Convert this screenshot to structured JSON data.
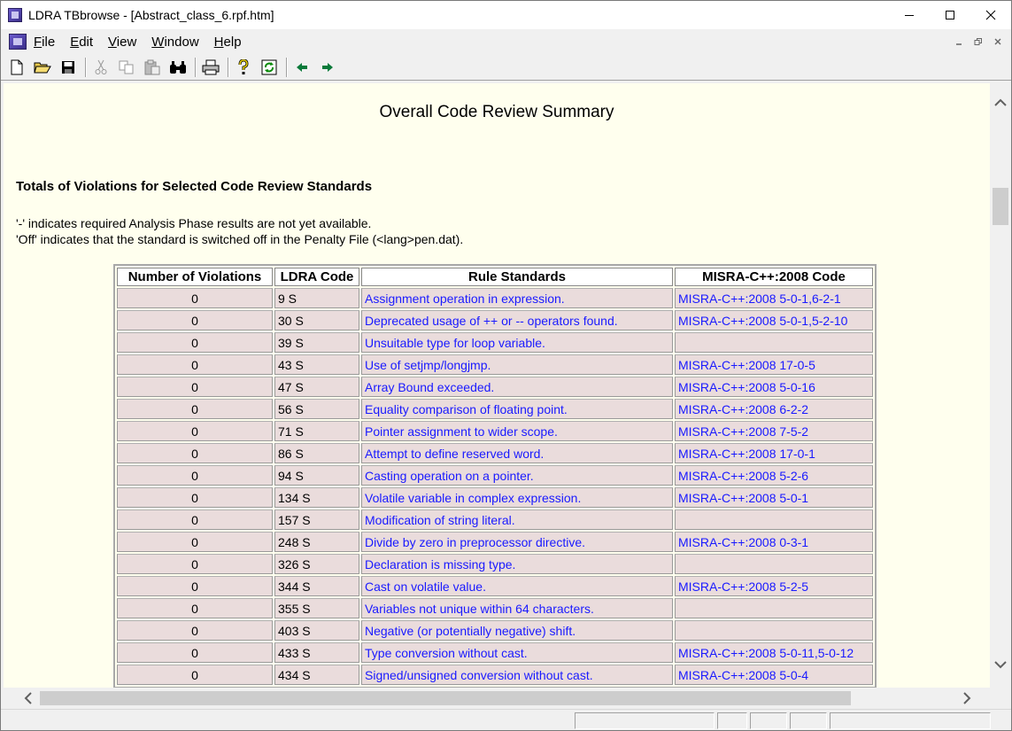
{
  "window": {
    "title": "LDRA TBbrowse - [Abstract_class_6.rpf.htm]",
    "app_icon": "ldra-app-icon",
    "controls": [
      "minimize-icon",
      "maximize-icon",
      "close-icon"
    ]
  },
  "menu": {
    "items": [
      {
        "hotkey": "F",
        "rest": "ile"
      },
      {
        "hotkey": "E",
        "rest": "dit"
      },
      {
        "hotkey": "V",
        "rest": "iew"
      },
      {
        "hotkey": "W",
        "rest": "indow"
      },
      {
        "hotkey": "H",
        "rest": "elp"
      }
    ],
    "mdi_controls": [
      "mdi-minimize-icon",
      "mdi-restore-icon",
      "mdi-close-icon"
    ]
  },
  "toolbar": {
    "buttons": [
      "new-icon",
      "open-icon",
      "save-icon",
      "cut-icon",
      "copy-icon",
      "paste-icon",
      "find-icon",
      "print-icon",
      "help-icon",
      "refresh-icon",
      "back-icon",
      "forward-icon"
    ]
  },
  "report": {
    "heading": "Overall Code Review Summary",
    "section_title": "Totals of Violations for Selected Code Review Standards",
    "note_1": "'-' indicates required Analysis Phase results are not yet available.",
    "note_2": "'Off' indicates that the standard is switched off in the Penalty File (<lang>pen.dat).",
    "table": {
      "headers": [
        "Number of Violations",
        "LDRA Code",
        "Rule Standards",
        "MISRA-C++:2008 Code"
      ],
      "rows": [
        {
          "violations": "0",
          "code": "9 S",
          "rule": "Assignment operation in expression.",
          "misra": "MISRA-C++:2008 5-0-1,6-2-1"
        },
        {
          "violations": "0",
          "code": "30 S",
          "rule": "Deprecated usage of ++ or -- operators found.",
          "misra": "MISRA-C++:2008 5-0-1,5-2-10"
        },
        {
          "violations": "0",
          "code": "39 S",
          "rule": "Unsuitable type for loop variable.",
          "misra": ""
        },
        {
          "violations": "0",
          "code": "43 S",
          "rule": "Use of setjmp/longjmp.",
          "misra": "MISRA-C++:2008 17-0-5"
        },
        {
          "violations": "0",
          "code": "47 S",
          "rule": "Array Bound exceeded.",
          "misra": "MISRA-C++:2008 5-0-16"
        },
        {
          "violations": "0",
          "code": "56 S",
          "rule": "Equality comparison of floating point.",
          "misra": "MISRA-C++:2008 6-2-2"
        },
        {
          "violations": "0",
          "code": "71 S",
          "rule": "Pointer assignment to wider scope.",
          "misra": "MISRA-C++:2008 7-5-2"
        },
        {
          "violations": "0",
          "code": "86 S",
          "rule": "Attempt to define reserved word.",
          "misra": "MISRA-C++:2008 17-0-1"
        },
        {
          "violations": "0",
          "code": "94 S",
          "rule": "Casting operation on a pointer.",
          "misra": "MISRA-C++:2008 5-2-6"
        },
        {
          "violations": "0",
          "code": "134 S",
          "rule": "Volatile variable in complex expression.",
          "misra": "MISRA-C++:2008 5-0-1"
        },
        {
          "violations": "0",
          "code": "157 S",
          "rule": "Modification of string literal.",
          "misra": ""
        },
        {
          "violations": "0",
          "code": "248 S",
          "rule": "Divide by zero in preprocessor directive.",
          "misra": "MISRA-C++:2008 0-3-1"
        },
        {
          "violations": "0",
          "code": "326 S",
          "rule": "Declaration is missing type.",
          "misra": ""
        },
        {
          "violations": "0",
          "code": "344 S",
          "rule": "Cast on volatile value.",
          "misra": "MISRA-C++:2008 5-2-5"
        },
        {
          "violations": "0",
          "code": "355 S",
          "rule": "Variables not unique within 64 characters.",
          "misra": ""
        },
        {
          "violations": "0",
          "code": "403 S",
          "rule": "Negative (or potentially negative) shift.",
          "misra": ""
        },
        {
          "violations": "0",
          "code": "433 S",
          "rule": "Type conversion without cast.",
          "misra": "MISRA-C++:2008 5-0-11,5-0-12"
        },
        {
          "violations": "0",
          "code": "434 S",
          "rule": "Signed/unsigned conversion without cast.",
          "misra": "MISRA-C++:2008 5-0-4"
        }
      ]
    }
  },
  "colors": {
    "page_background": "#ffffee",
    "cell_background": "#eadcdc",
    "link_text": "#1a1aff"
  }
}
